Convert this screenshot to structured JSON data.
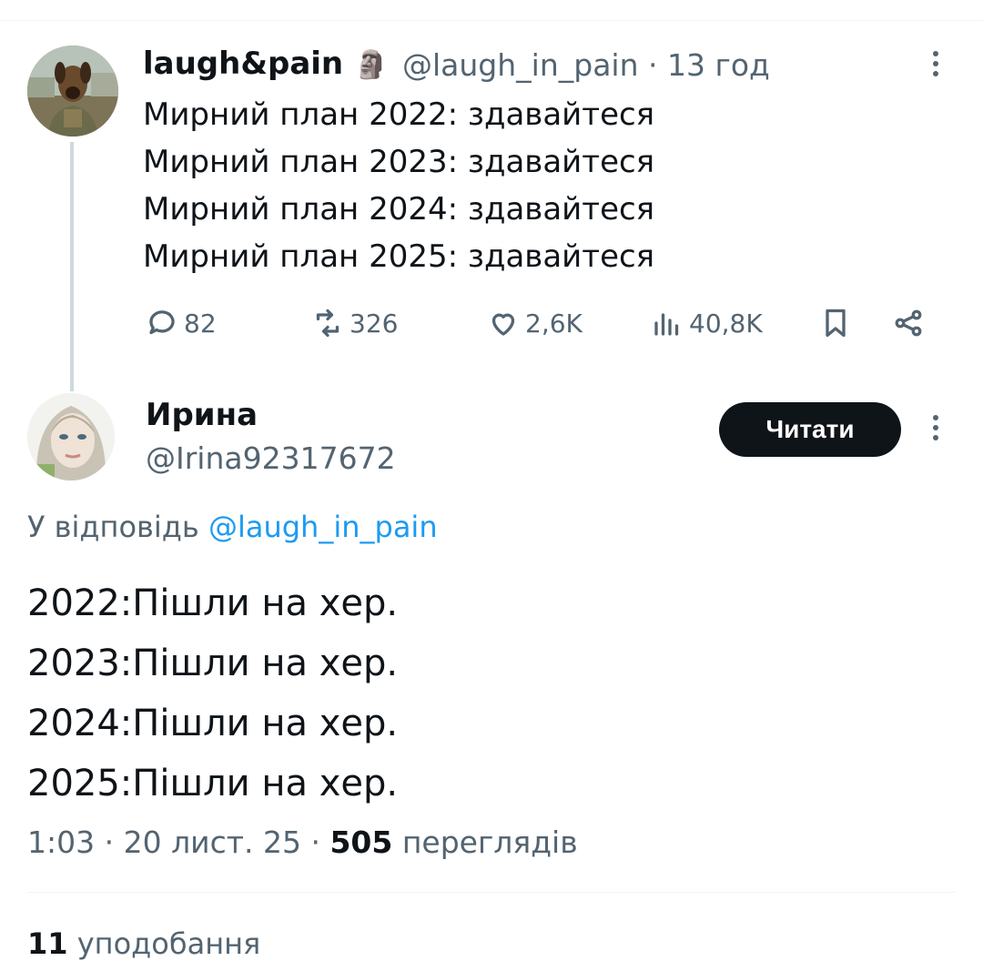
{
  "original_tweet": {
    "author_name": "laugh&pain",
    "author_emoji": "🗿",
    "handle": "@laugh_in_pain",
    "time_ago": "13 год",
    "lines": [
      "Мирний план 2022: здавайтеся",
      "Мирний план 2023: здавайтеся",
      "Мирний план 2024: здавайтеся",
      "Мирний план 2025: здавайтеся"
    ],
    "stats": {
      "replies": "82",
      "reposts": "326",
      "likes": "2,6K",
      "views": "40,8K"
    }
  },
  "reply": {
    "author_name": "Ирина",
    "handle": "@Irina92317672",
    "follow_label": "Читати",
    "reply_prefix": "У відповідь",
    "reply_to": "@laugh_in_pain",
    "lines": [
      "2022:Пішли на хер.",
      "2023:Пішли на хер.",
      "2024:Пішли на хер.",
      "2025:Пішли на хер."
    ],
    "time": "1:03",
    "date": "20 лист. 25",
    "views_count": "505",
    "views_label": "переглядів",
    "likes_count": "11",
    "likes_label": "уподобання"
  }
}
